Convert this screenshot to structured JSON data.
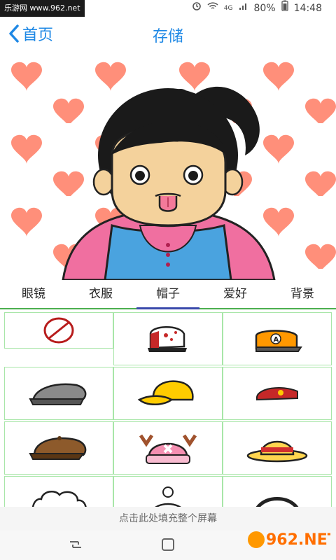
{
  "status": {
    "watermark_text": "乐游网 www.962.net",
    "signal": "4G",
    "battery": "80%",
    "time": "14:48"
  },
  "appbar": {
    "back_label": "首页",
    "title": "存储"
  },
  "tabs": [
    {
      "label": "眼镜",
      "active": false
    },
    {
      "label": "衣服",
      "active": false
    },
    {
      "label": "帽子",
      "active": true
    },
    {
      "label": "爱好",
      "active": false
    },
    {
      "label": "背景",
      "active": false
    }
  ],
  "items": [
    {
      "icon": "none-icon"
    },
    {
      "icon": "baseball-cap-icon"
    },
    {
      "icon": "orange-cap-icon"
    },
    {
      "icon": "gray-flat-cap-icon"
    },
    {
      "icon": "yellow-cap-icon"
    },
    {
      "icon": "red-beret-icon"
    },
    {
      "icon": "brown-newsboy-cap-icon"
    },
    {
      "icon": "chopper-hat-icon"
    },
    {
      "icon": "straw-hat-icon"
    },
    {
      "icon": "white-fluffy-hat-icon"
    },
    {
      "icon": "winter-beanie-icon"
    },
    {
      "icon": "headphones-icon"
    }
  ],
  "bottom_bar": {
    "text": "点击此处填充整个屏幕"
  },
  "watermark": {
    "brand": "962.NET",
    "sub": "乐游网"
  },
  "colors": {
    "accent": "#1e88e5",
    "tab_border": "#4caf50",
    "tab_active": "#3949ab",
    "hearts": "#ff8f7a"
  }
}
